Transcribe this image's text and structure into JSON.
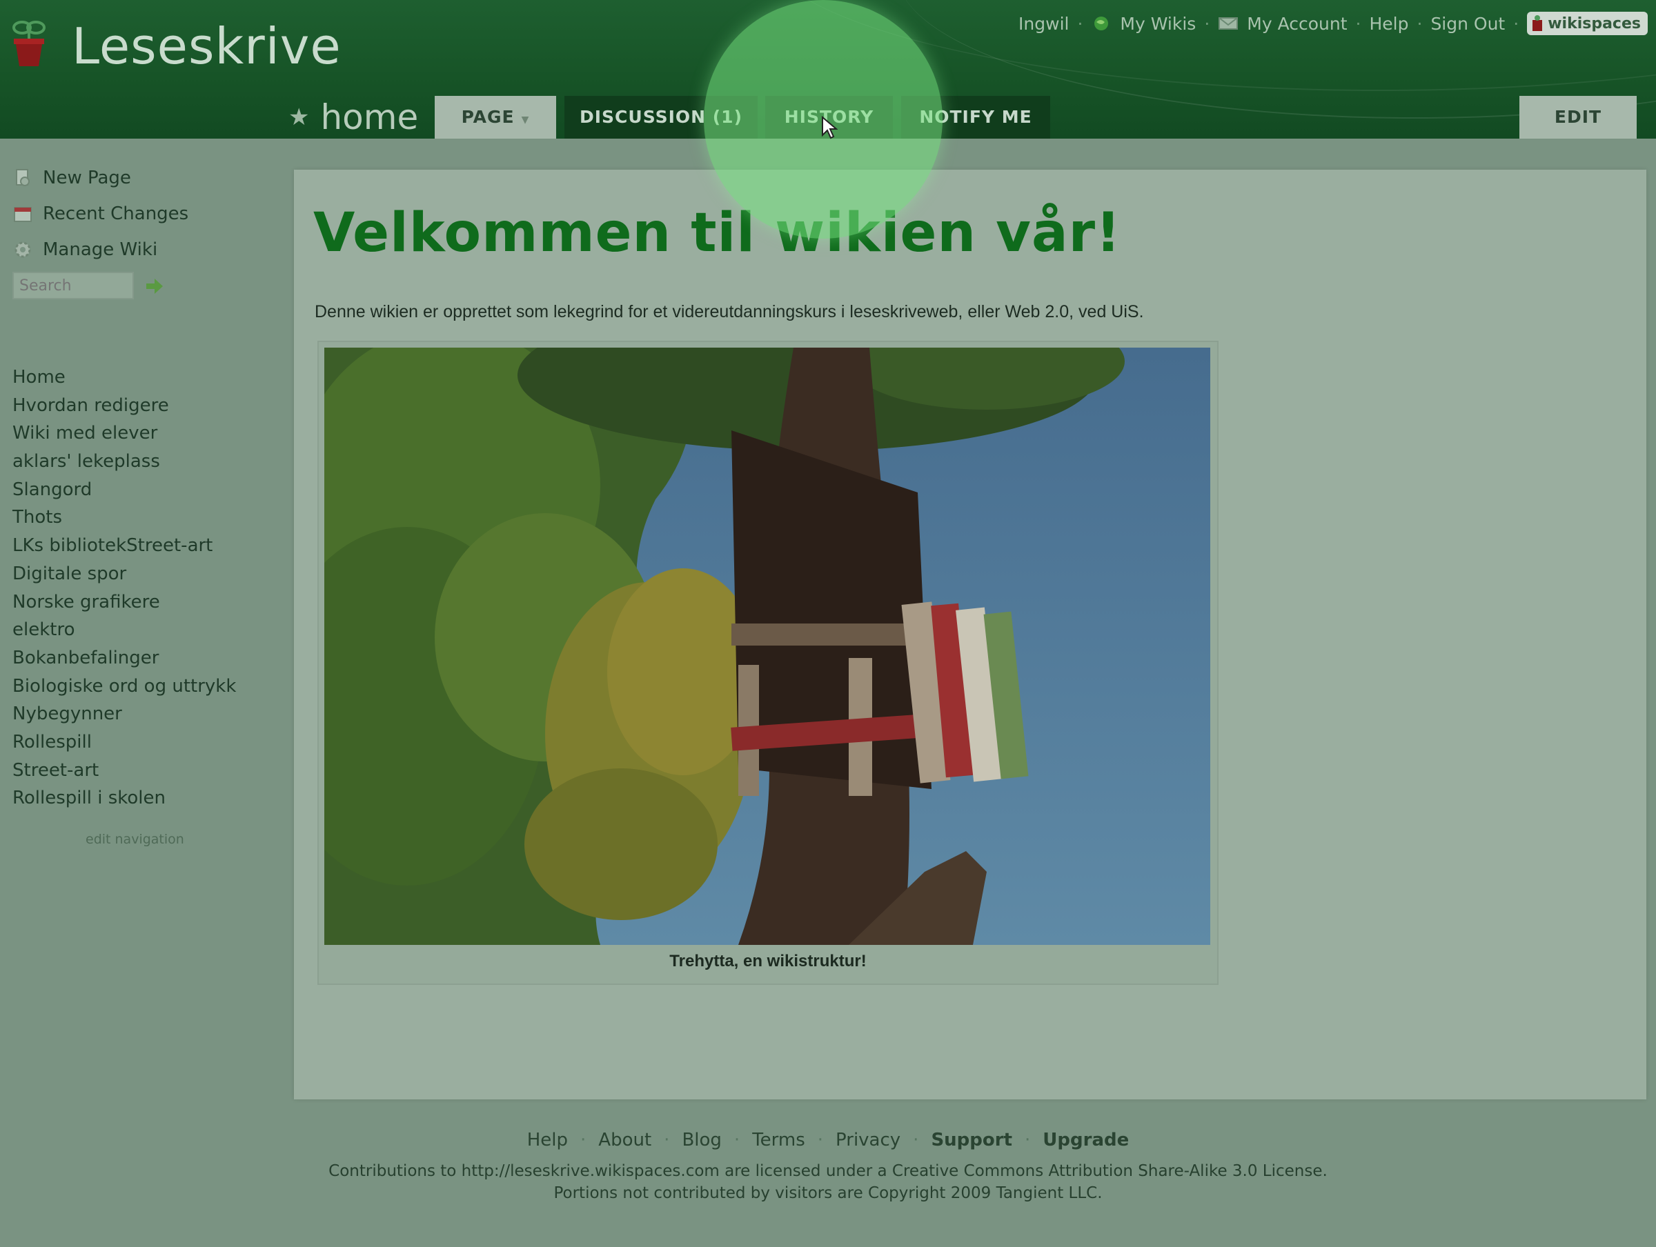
{
  "header": {
    "site_title": "Leseskrive",
    "top_links": {
      "user": "Ingwil",
      "my_wikis": "My Wikis",
      "my_account": "My Account",
      "help": "Help",
      "sign_out": "Sign Out",
      "sep": "·",
      "badge": "wikispaces"
    },
    "page_name": "home",
    "page_star": "★",
    "tabs": {
      "page": "PAGE",
      "page_caret": "▼",
      "discussion": "DISCUSSION (1)",
      "history": "HISTORY",
      "notify": "NOTIFY ME",
      "edit": "EDIT"
    }
  },
  "sidebar": {
    "actions": {
      "new_page": "New Page",
      "recent_changes": "Recent Changes",
      "manage_wiki": "Manage Wiki"
    },
    "search_placeholder": "Search",
    "nav": [
      "Home",
      "Hvordan redigere",
      "Wiki med elever",
      "aklars' lekeplass",
      "Slangord",
      "Thots",
      "LKs bibliotekStreet-art",
      "Digitale spor",
      "Norske grafikere",
      "elektro",
      "Bokanbefalinger",
      "Biologiske ord og uttrykk",
      "Nybegynner",
      "Rollespill",
      "Street-art",
      "Rollespill i skolen"
    ],
    "edit_navigation": "edit navigation"
  },
  "content": {
    "title": "Velkommen til wikien vår!",
    "intro": "Denne wikien er opprettet som lekegrind for et videreutdanningskurs i leseskriveweb, eller Web 2.0, ved UiS.",
    "caption": "Trehytta, en wikistruktur!"
  },
  "footer": {
    "links": {
      "help": "Help",
      "about": "About",
      "blog": "Blog",
      "terms": "Terms",
      "privacy": "Privacy",
      "support": "Support",
      "upgrade": "Upgrade",
      "sep": "·"
    },
    "license_line1": "Contributions to http://leseskrive.wikispaces.com are licensed under a Creative Commons Attribution Share-Alike 3.0 License.",
    "license_line2": "Portions not contributed by visitors are Copyright 2009 Tangient LLC."
  },
  "icons": {
    "logo": "flower-pot-icon",
    "my_wikis": "globe-icon",
    "my_account": "mail-icon",
    "new_page": "new-page-icon",
    "recent_changes": "calendar-icon",
    "manage_wiki": "gear-icon",
    "search_go": "arrow-right-icon"
  },
  "colors": {
    "header_green": "#175427",
    "title_green": "#0f6b1c",
    "highlight": "#78e682"
  }
}
